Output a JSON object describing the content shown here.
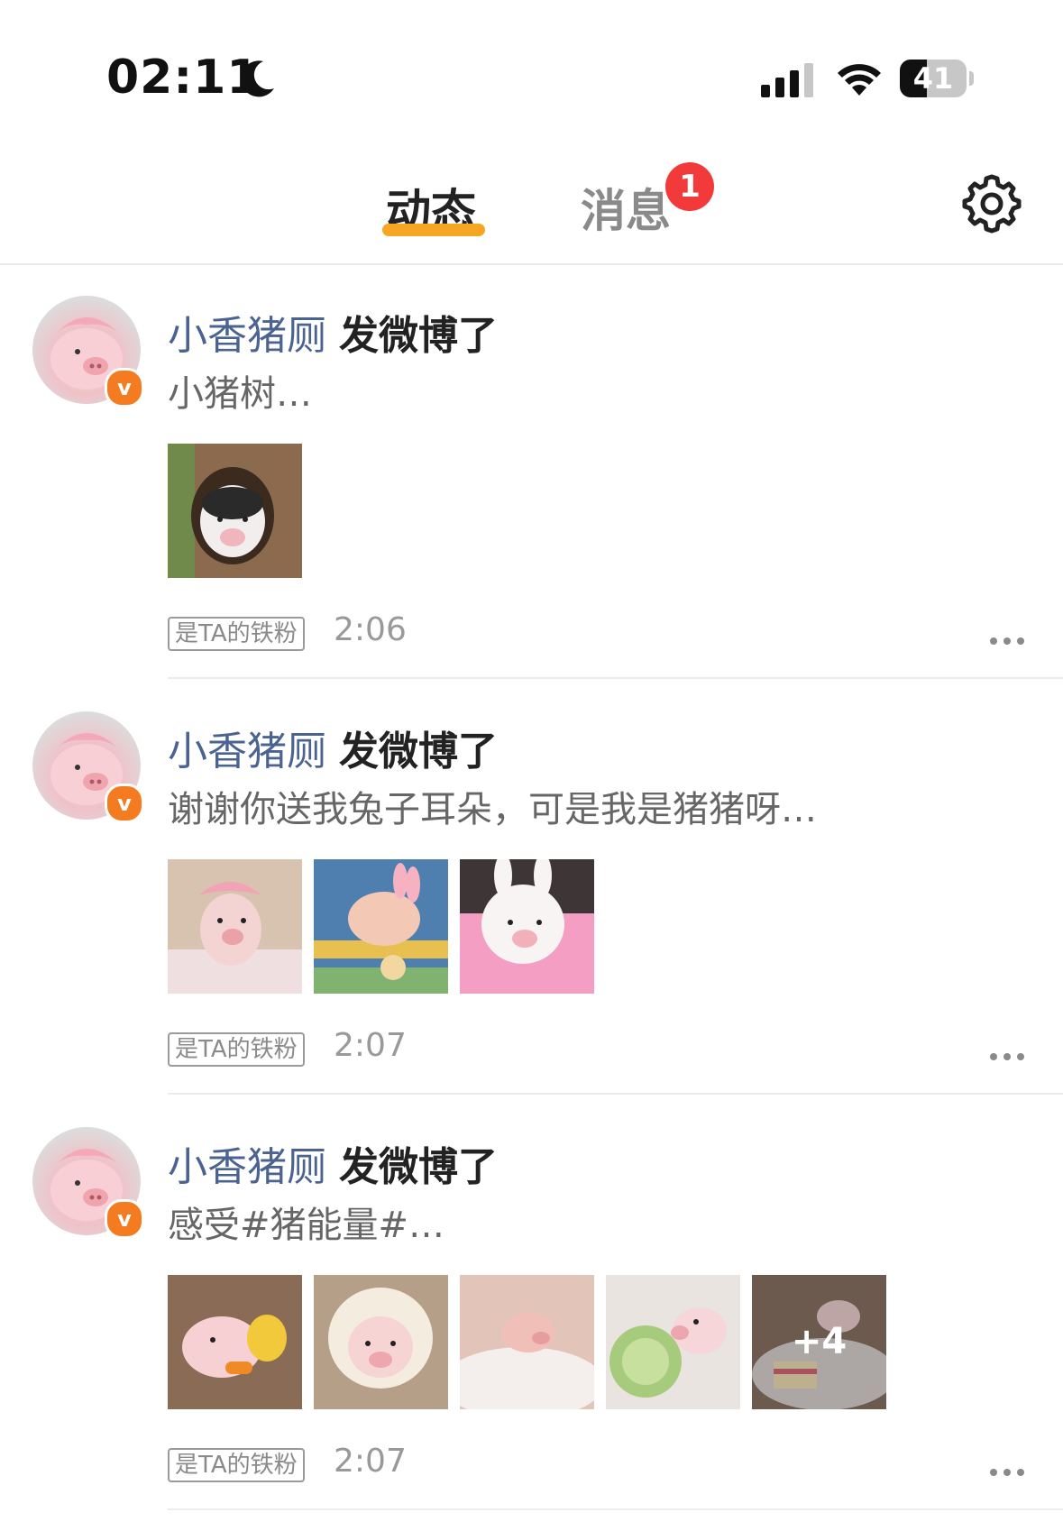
{
  "status_bar": {
    "time": "02:11",
    "moon_icon": "moon-icon",
    "signal_icon": "cellular-signal-icon",
    "wifi_icon": "wifi-icon",
    "battery_icon": "battery-icon",
    "battery_level": "41",
    "battery_fraction": 0.41
  },
  "nav": {
    "tabs": [
      {
        "label": "动态",
        "active": true
      },
      {
        "label": "消息",
        "active": false,
        "badge": "1"
      }
    ],
    "settings_icon": "gear-icon",
    "accent_color": "#f6a623",
    "badge_color": "#f33a3a"
  },
  "feed": {
    "username_color": "#4a6391",
    "posts": [
      {
        "username": "小香猪厕",
        "action": "发微博了",
        "excerpt": "小猪树…",
        "images": [
          "pig-in-tree-hole"
        ],
        "tag": "是TA的铁粉",
        "time": "2:06"
      },
      {
        "username": "小香猪厕",
        "action": "发微博了",
        "excerpt": "谢谢你送我兔子耳朵，可是我是猪猪呀…",
        "images": [
          "pig-pink-hat",
          "pig-bunny-ears-blanket",
          "pig-white-bunny-hat"
        ],
        "tag": "是TA的铁粉",
        "time": "2:07"
      },
      {
        "username": "小香猪厕",
        "action": "发微博了",
        "excerpt": "感受#猪能量#…",
        "images": [
          "pig-with-duck-toy",
          "pig-in-hood",
          "pig-sleeping",
          "pig-with-cabbage",
          "pig-with-cake"
        ],
        "more_count": "+4",
        "tag": "是TA的铁粉",
        "time": "2:07"
      }
    ]
  }
}
